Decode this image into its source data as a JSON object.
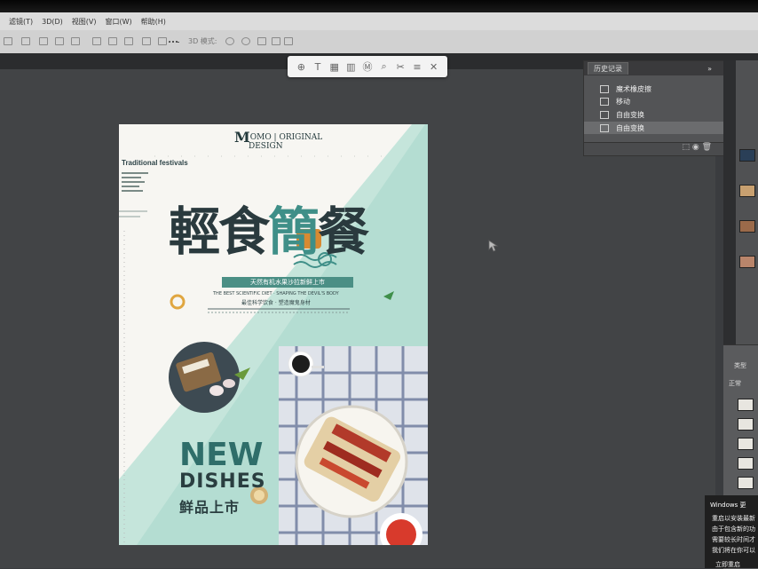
{
  "menu": {
    "items": [
      "滤镜(T)",
      "3D(D)",
      "视图(V)",
      "窗口(W)",
      "帮助(H)"
    ]
  },
  "options_bar": {
    "mode_label": "3D 模式:"
  },
  "floating_toolbar": {
    "icons": [
      "crosshair-icon",
      "text-icon",
      "grid-icon",
      "columns-icon",
      "mask-icon",
      "search-icon",
      "scissors-icon",
      "menu-icon",
      "close-icon"
    ],
    "glyphs": [
      "⊕",
      "T",
      "▦",
      "▥",
      "Ⓜ",
      "⌕",
      "✂",
      "≡",
      "✕"
    ]
  },
  "history_panel": {
    "tab": "历史记录",
    "collapse": "»",
    "steps": [
      "魔术橡皮擦",
      "移动",
      "自由变换",
      "自由变换"
    ],
    "bottom_glyphs": "⬚  ◉  🗑"
  },
  "right_panel": {
    "filter": "类型",
    "blend": "正常"
  },
  "toast": {
    "title": "Windows 更",
    "lines": [
      "重启以安装最新",
      "由于包含新的功",
      "需要较长时间才",
      "我们将在你可以"
    ],
    "button": "立即重启"
  },
  "poster": {
    "brand_mark": "M",
    "brand_text": "OMO | ORIGINAL",
    "brand_text2": "DESIGN",
    "tagline": "Traditional festivals",
    "headline": [
      "輕",
      "食",
      "簡",
      "餐"
    ],
    "ribbon": "天然有机水果沙拉新鲜上市",
    "subline_en": "THE BEST SCIENTIFIC DIET · SHAPING THE DEVIL'S BODY",
    "subline_cn": "最佳科学饮食 · 塑造魔鬼身材",
    "new": "NEW",
    "dishes": "DISHES",
    "fresh": "鲜品上市"
  },
  "colors": {
    "accent_teal": "#4b8f85",
    "dark_text": "#2a3a3e",
    "panel": "#535456"
  }
}
